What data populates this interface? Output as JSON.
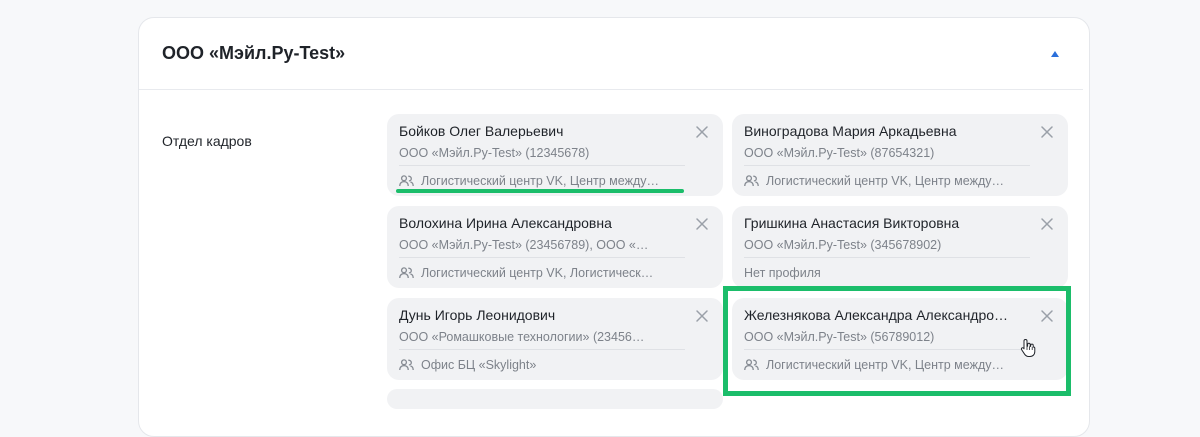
{
  "section": {
    "title": "ООО «Мэйл.Ру-Test»",
    "collapse_icon": "chevron-up-icon",
    "accent_color": "#2a6fdb"
  },
  "department": {
    "label": "Отдел кадров"
  },
  "employees": [
    {
      "name": "Бойков Олег Валерьевич",
      "org": "ООО «Мэйл.Ру-Test» (12345678)",
      "profile": "Логистический центр VK, Центр между…",
      "has_profile_icon": true
    },
    {
      "name": "Виноградова Мария Аркадьевна",
      "org": "ООО «Мэйл.Ру-Test» (87654321)",
      "profile": "Логистический центр VK, Центр между…",
      "has_profile_icon": true
    },
    {
      "name": "Волохина Ирина Александровна",
      "org": "ООО «Мэйл.Ру-Test» (23456789), ООО «…",
      "profile": "Логистический центр VK, Логистическ…",
      "has_profile_icon": true
    },
    {
      "name": "Гришкина Анастасия Викторовна",
      "org": "ООО «Мэйл.Ру-Test» (345678902)",
      "profile": "Нет профиля",
      "has_profile_icon": false
    },
    {
      "name": "Дунь Игорь Леонидович",
      "org": "ООО «Ромашковые технологии» (23456…",
      "profile": "Офис БЦ «Skylight»",
      "has_profile_icon": true
    },
    {
      "name": "Железнякова Александра Александро…",
      "org": "ООО «Мэйл.Ру-Test» (56789012)",
      "profile": "Логистический центр VK, Центр между…",
      "has_profile_icon": true
    }
  ],
  "annotations": {
    "highlight_color": "#1bbd6a"
  }
}
